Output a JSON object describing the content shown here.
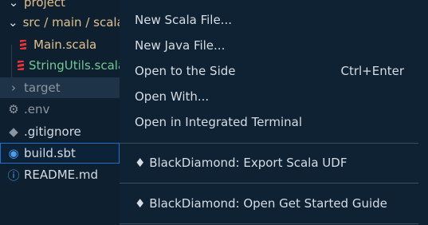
{
  "explorer": {
    "items": [
      {
        "label": "project",
        "kind": "folder-open"
      },
      {
        "label": "src / main / scala",
        "kind": "folder-open"
      },
      {
        "label": "Main.scala",
        "kind": "scala"
      },
      {
        "label": "StringUtils.scala",
        "kind": "scala"
      },
      {
        "label": "target",
        "kind": "folder-closed"
      },
      {
        "label": ".env",
        "kind": "gear"
      },
      {
        "label": ".gitignore",
        "kind": "git"
      },
      {
        "label": "build.sbt",
        "kind": "sbt"
      },
      {
        "label": "README.md",
        "kind": "info"
      }
    ]
  },
  "menu": {
    "items": [
      {
        "label": "New Scala File...",
        "shortcut": ""
      },
      {
        "label": "New Java File...",
        "shortcut": ""
      },
      {
        "label": "Open to the Side",
        "shortcut": "Ctrl+Enter"
      },
      {
        "label": "Open With...",
        "shortcut": ""
      },
      {
        "label": "Open in Integrated Terminal",
        "shortcut": ""
      },
      {
        "label": "♦ BlackDiamond: Export Scala UDF",
        "shortcut": ""
      },
      {
        "label": "♦ BlackDiamond: Open Get Started Guide",
        "shortcut": ""
      }
    ]
  }
}
